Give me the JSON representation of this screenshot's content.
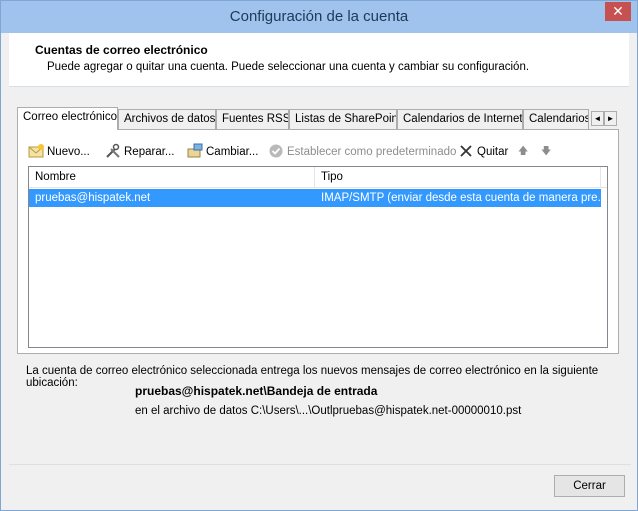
{
  "window": {
    "title": "Configuración de la cuenta",
    "close_glyph": "✕"
  },
  "header": {
    "title": "Cuentas de correo electrónico",
    "description": "Puede agregar o quitar una cuenta. Puede seleccionar una cuenta y cambiar su configuración."
  },
  "tabs": [
    {
      "label": "Correo electrónico",
      "active": true
    },
    {
      "label": "Archivos de datos",
      "active": false
    },
    {
      "label": "Fuentes RSS",
      "active": false
    },
    {
      "label": "Listas de SharePoint",
      "active": false
    },
    {
      "label": "Calendarios de Internet",
      "active": false
    },
    {
      "label": "Calendarios p",
      "active": false
    }
  ],
  "tab_scroll": {
    "left": "◄",
    "right": "►"
  },
  "toolbar": {
    "new_label": "Nuevo...",
    "repair_label": "Reparar...",
    "change_label": "Cambiar...",
    "set_default_label": "Establecer como predeterminado",
    "remove_label": "Quitar",
    "up_glyph": "🡅",
    "down_glyph": "🡇"
  },
  "list": {
    "columns": [
      "Nombre",
      "Tipo"
    ],
    "rows": [
      {
        "name": "pruebas@hispatek.net",
        "type": "IMAP/SMTP (enviar desde esta cuenta de manera pre..."
      }
    ]
  },
  "info": {
    "text": "La cuenta de correo electrónico seleccionada entrega los nuevos mensajes de correo electrónico en la siguiente ubicación:",
    "location": "pruebas@hispatek.net\\Bandeja de entrada",
    "data_file": "en el archivo de datos C:\\Users\\...\\Outlpruebas@hispatek.net-00000010.pst"
  },
  "footer": {
    "close_label": "Cerrar"
  },
  "colors": {
    "titlebar": "#9fc3ec",
    "close": "#c75050",
    "selection": "#3399ff"
  }
}
